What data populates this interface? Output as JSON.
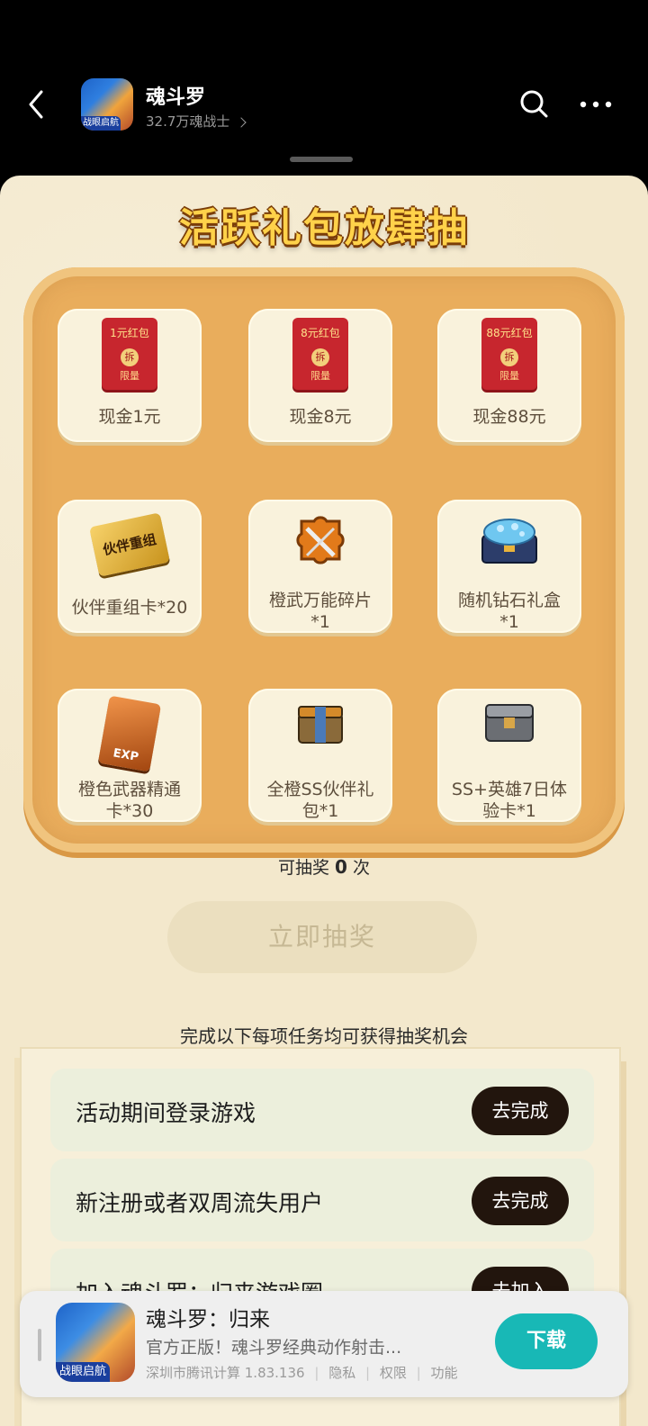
{
  "header": {
    "game_name": "魂斗罗",
    "followers": "32.7万魂战士",
    "avatar_badge": "战眼启航"
  },
  "promo": {
    "title": "活跃礼包放肆抽",
    "prizes": [
      {
        "label": "现金1元",
        "envelope_text": "1元红包",
        "seal": "拆",
        "limit": "限量"
      },
      {
        "label": "现金8元",
        "envelope_text": "8元红包",
        "seal": "拆",
        "limit": "限量"
      },
      {
        "label": "现金88元",
        "envelope_text": "88元红包",
        "seal": "拆",
        "limit": "限量"
      },
      {
        "label": "伙伴重组卡*20",
        "card_text": "伙伴重组"
      },
      {
        "label_line1": "橙武万能碎片",
        "label_line2": "*1"
      },
      {
        "label_line1": "随机钻石礼盒",
        "label_line2": "*1"
      },
      {
        "label_line1": "橙色武器精通",
        "label_line2": "卡*30",
        "card_text": "EXP"
      },
      {
        "label_line1": "全橙SS伙伴礼",
        "label_line2": "包*1"
      },
      {
        "label_line1": "SS+英雄7日体",
        "label_line2": "验卡*1"
      }
    ],
    "draw_count_prefix": "可抽奖",
    "draw_count": "0",
    "draw_count_suffix": "次",
    "draw_button": "立即抽奖",
    "task_hint": "完成以下每项任务均可获得抽奖机会"
  },
  "tasks": [
    {
      "label": "活动期间登录游戏",
      "button": "去完成"
    },
    {
      "label": "新注册或者双周流失用户",
      "button": "去完成"
    },
    {
      "label": "加入魂斗罗：归来游戏圈",
      "button": "去加入"
    }
  ],
  "download_banner": {
    "app_title": "魂斗罗：归来",
    "description": "官方正版！魂斗罗经典动作射击...",
    "developer_version": "深圳市腾讯计算 1.83.136",
    "privacy": "隐私",
    "permissions": "权限",
    "features": "功能",
    "icon_badge": "战眼启航",
    "download_button": "下载"
  },
  "colors": {
    "header_bg": "#000000",
    "panel_bg": "#f3e8cc",
    "board": "#e9ad5c",
    "task_button": "#22150d",
    "download_button": "#18b8b6"
  }
}
